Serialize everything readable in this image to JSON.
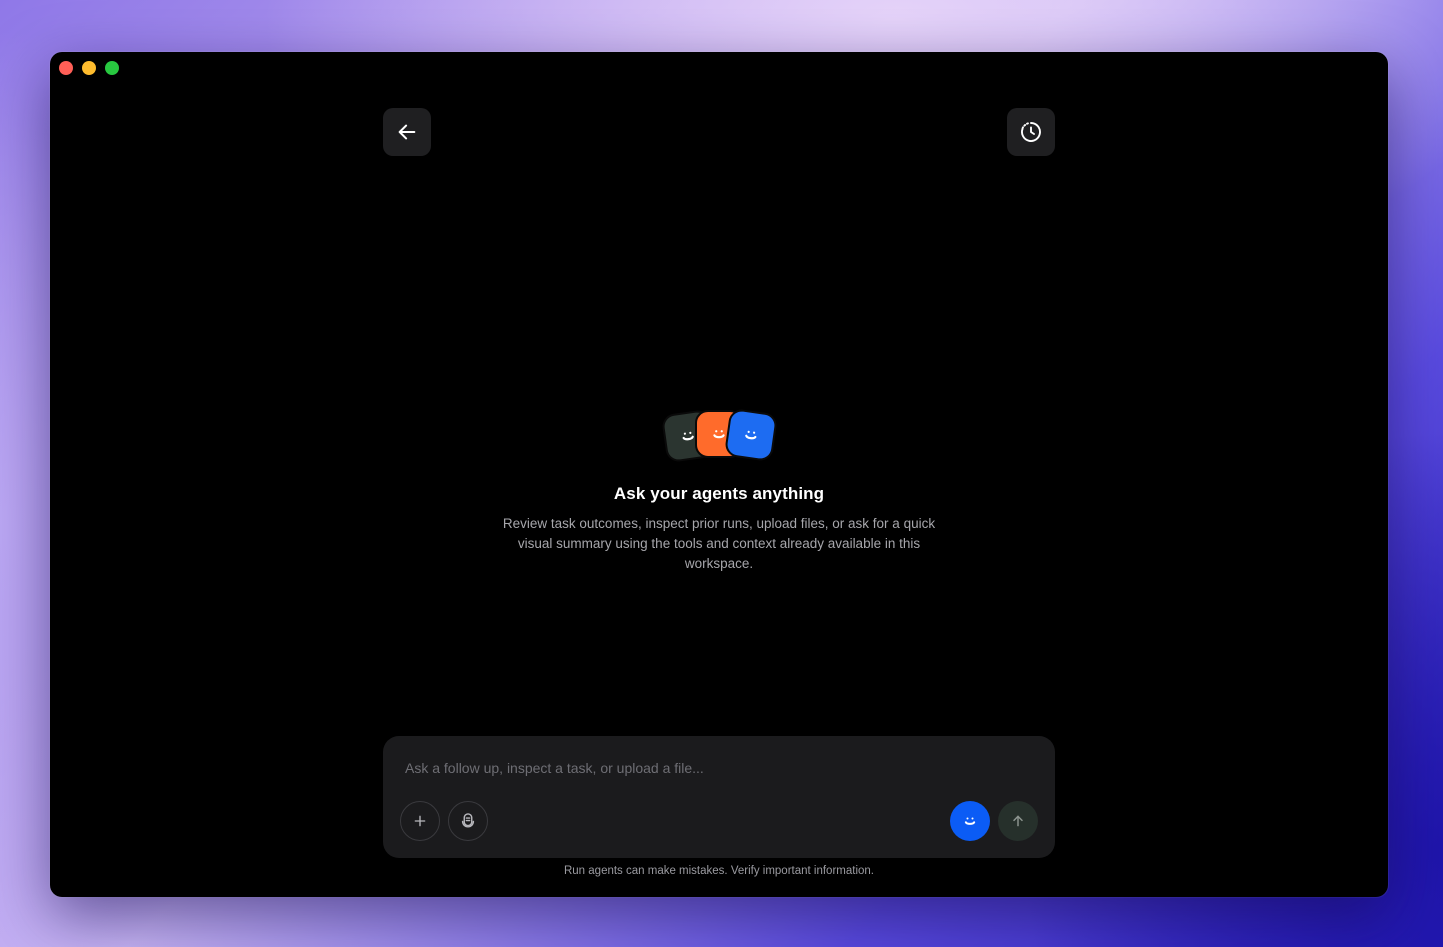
{
  "window": {
    "traffic_lights": [
      "close",
      "minimize",
      "zoom"
    ]
  },
  "toolbar": {
    "back_icon": "arrow-left-icon",
    "history_icon": "history-clock-icon"
  },
  "hero": {
    "avatars": [
      {
        "name": "agent-avatar-dark",
        "color": "#2b3530"
      },
      {
        "name": "agent-avatar-orange",
        "color": "#ff6b2b"
      },
      {
        "name": "agent-avatar-blue",
        "color": "#1d6cf2"
      }
    ],
    "title": "Ask your agents anything",
    "description": "Review task outcomes, inspect prior runs, upload files, or ask for a quick visual summary using the tools and context already available in this workspace."
  },
  "composer": {
    "placeholder": "Ask a follow up, inspect a task, or upload a file...",
    "value": "",
    "attach_icon": "plus-icon",
    "voice_icon": "microphone-icon",
    "agent_icon": "smiley-icon",
    "send_icon": "arrow-up-icon"
  },
  "footer": {
    "disclaimer": "Run agents can make mistakes. Verify important information."
  },
  "colors": {
    "accent_blue": "#0b5cf5",
    "window_bg": "#000000",
    "composer_bg": "#1b1b1d"
  }
}
